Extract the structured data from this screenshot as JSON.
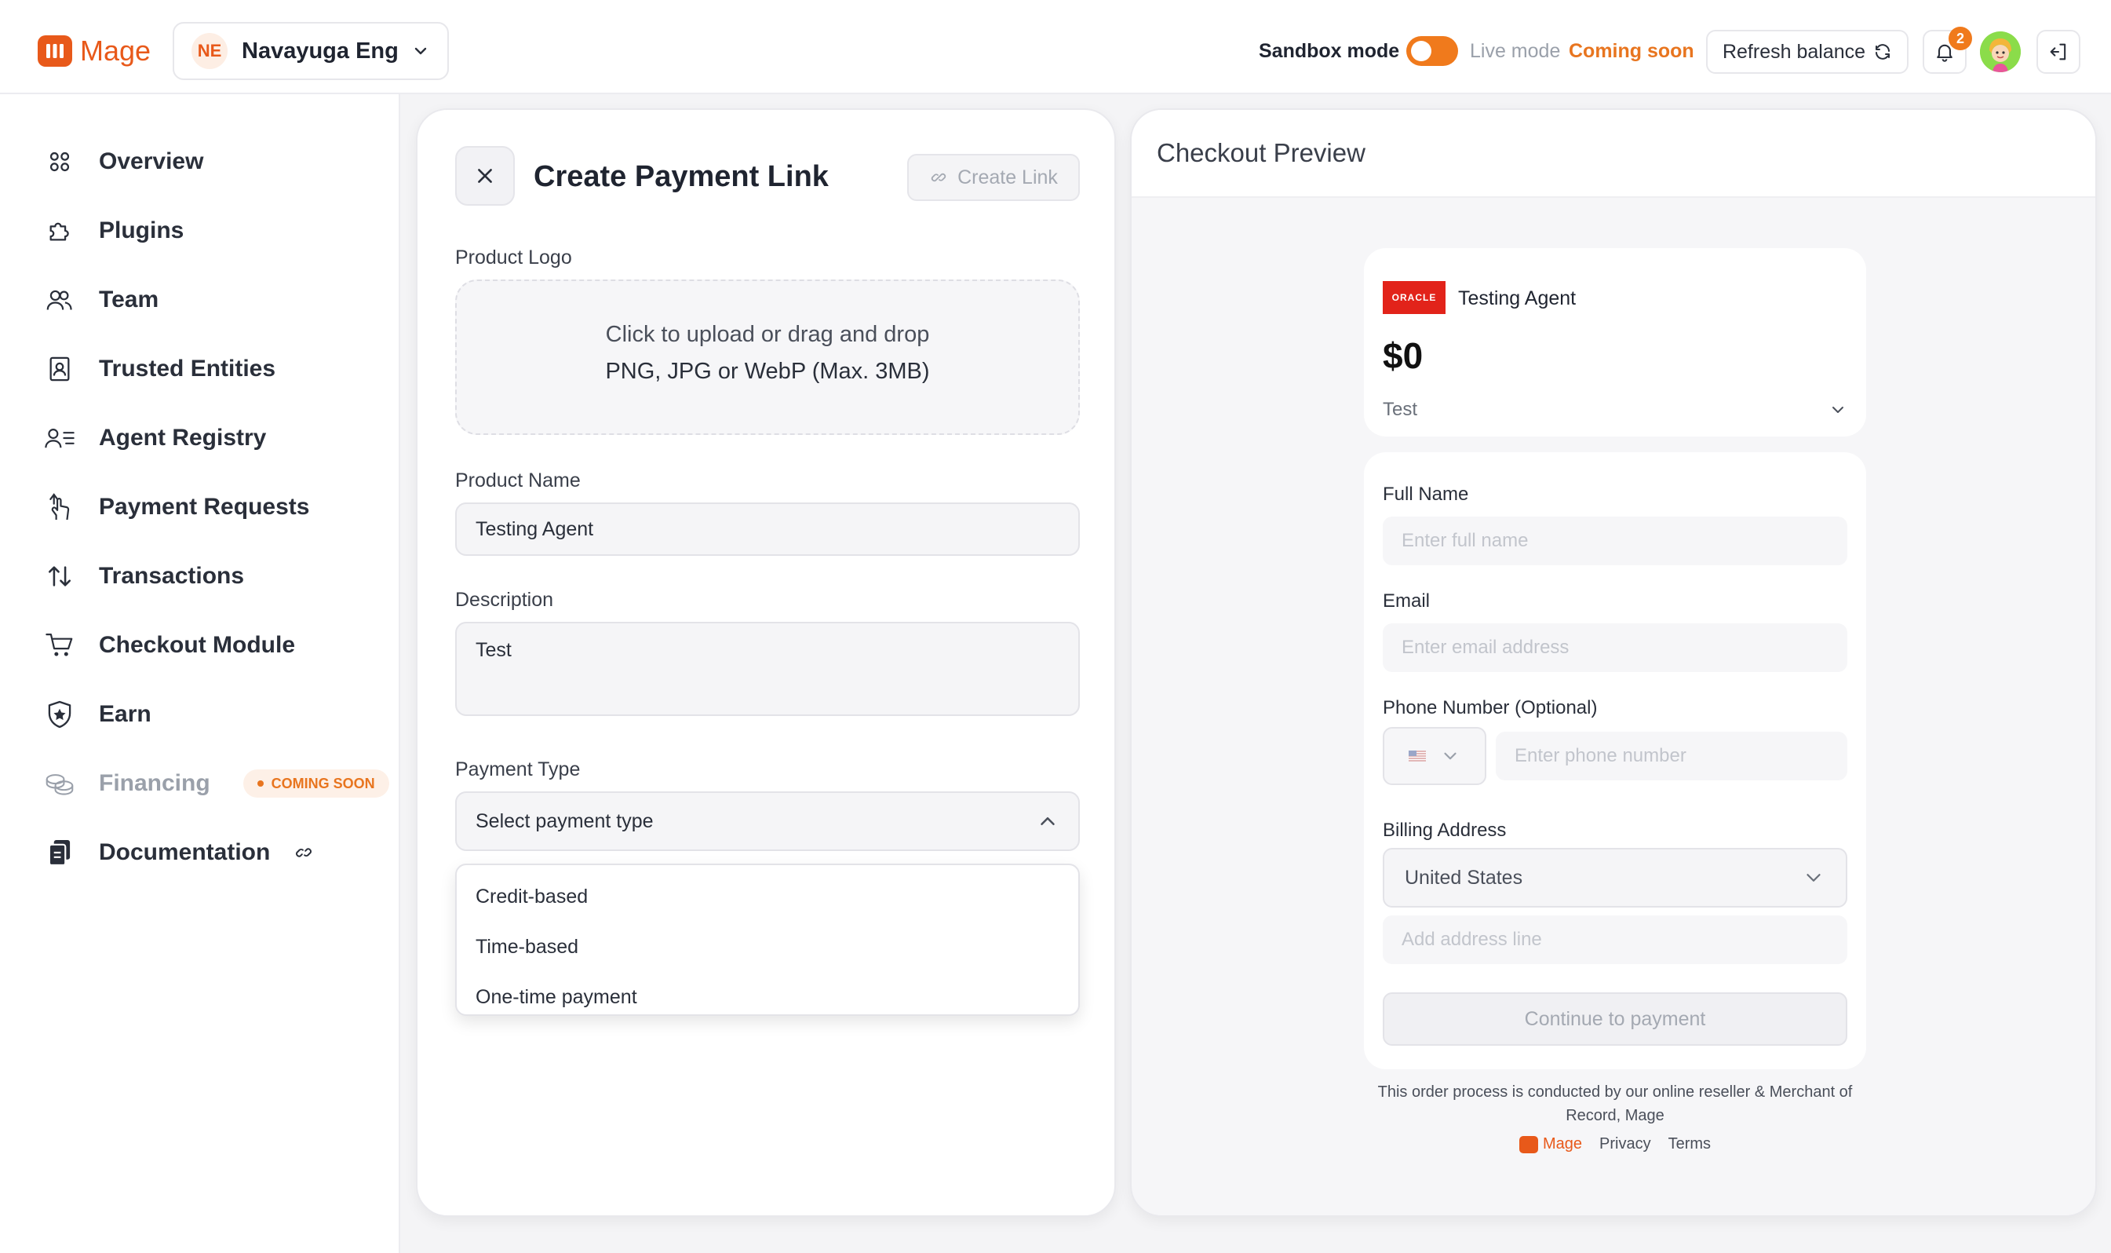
{
  "brand": {
    "name": "Mage",
    "color": "#e8591a"
  },
  "org": {
    "initials": "NE",
    "name": "Navayuga Eng"
  },
  "header": {
    "sandbox_label": "Sandbox mode",
    "sandbox_on": true,
    "live_label": "Live mode",
    "coming_soon": "Coming soon",
    "refresh_label": "Refresh balance",
    "notification_count": "2"
  },
  "sidebar": {
    "items": [
      {
        "label": "Overview",
        "icon": "grid-icon"
      },
      {
        "label": "Plugins",
        "icon": "puzzle-icon"
      },
      {
        "label": "Team",
        "icon": "users-icon"
      },
      {
        "label": "Trusted Entities",
        "icon": "id-card-icon"
      },
      {
        "label": "Agent Registry",
        "icon": "user-list-icon"
      },
      {
        "label": "Payment Requests",
        "icon": "hand-pointer-icon"
      },
      {
        "label": "Transactions",
        "icon": "arrows-up-down-icon"
      },
      {
        "label": "Checkout Module",
        "icon": "cart-icon"
      },
      {
        "label": "Earn",
        "icon": "shield-star-icon"
      },
      {
        "label": "Financing",
        "icon": "coins-icon",
        "badge": "COMING SOON"
      },
      {
        "label": "Documentation",
        "icon": "docs-icon"
      }
    ]
  },
  "create": {
    "title": "Create Payment Link",
    "create_link_label": "Create Link",
    "logo_label": "Product Logo",
    "upload_line1": "Click to upload or drag and drop",
    "upload_line2": "PNG, JPG or WebP (Max. 3MB)",
    "name_label": "Product Name",
    "name_value": "Testing Agent",
    "description_label": "Description",
    "description_value": "Test",
    "payment_type_label": "Payment Type",
    "payment_type_placeholder": "Select payment type",
    "payment_type_options": [
      "Credit-based",
      "Time-based",
      "One-time payment"
    ]
  },
  "preview": {
    "title": "Checkout Preview",
    "logo_text": "ORACLE",
    "product_name": "Testing Agent",
    "price": "$0",
    "product_description": "Test",
    "full_name_label": "Full Name",
    "full_name_placeholder": "Enter full name",
    "email_label": "Email",
    "email_placeholder": "Enter email address",
    "phone_label": "Phone Number (Optional)",
    "phone_placeholder": "Enter phone number",
    "billing_label": "Billing Address",
    "country_value": "United States",
    "address_placeholder": "Add address line",
    "continue_label": "Continue to payment",
    "footer_note": "This order process is conducted by our online reseller & Merchant of Record, Mage",
    "footer_brand": "Mage",
    "privacy_label": "Privacy",
    "terms_label": "Terms"
  }
}
